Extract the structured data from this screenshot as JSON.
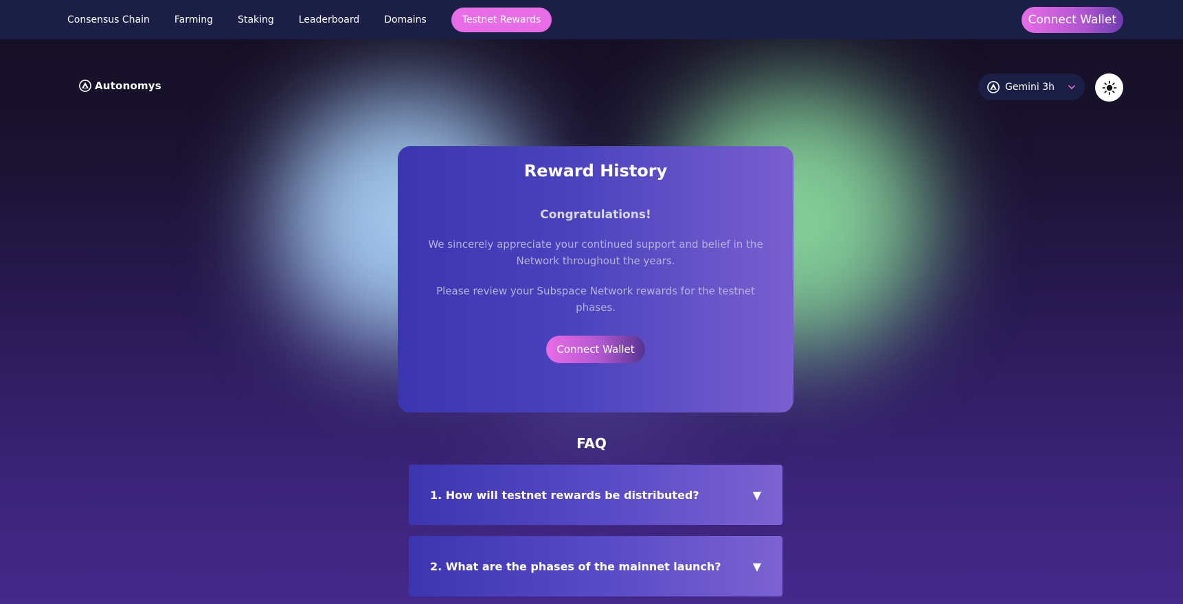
{
  "nav": {
    "links": [
      {
        "label": "Consensus Chain"
      },
      {
        "label": "Farming"
      },
      {
        "label": "Staking"
      },
      {
        "label": "Leaderboard"
      },
      {
        "label": "Domains"
      }
    ],
    "active_pill": "Testnet Rewards",
    "connect_label": "Connect Wallet"
  },
  "header": {
    "brand": "Autonomys",
    "network": "Gemini 3h",
    "theme_icon": "sun-icon"
  },
  "reward_card": {
    "title": "Reward History",
    "subtitle": "Congratulations!",
    "paragraph1": "We sincerely appreciate your continued support and belief in the Network throughout the years.",
    "paragraph2": "Please review your Subspace Network rewards for the testnet phases.",
    "connect_label": "Connect Wallet"
  },
  "faq": {
    "title": "FAQ",
    "items": [
      {
        "question": "1. How will testnet rewards be distributed?",
        "toggle": "▼"
      },
      {
        "question": "2. What are the phases of the mainnet launch?",
        "toggle": "▼"
      }
    ]
  },
  "colors": {
    "nav_bg": "#1c1f45",
    "accent_pink": "#e86ce6",
    "card_start": "#3c35b0",
    "card_end": "#7a5fd0"
  }
}
